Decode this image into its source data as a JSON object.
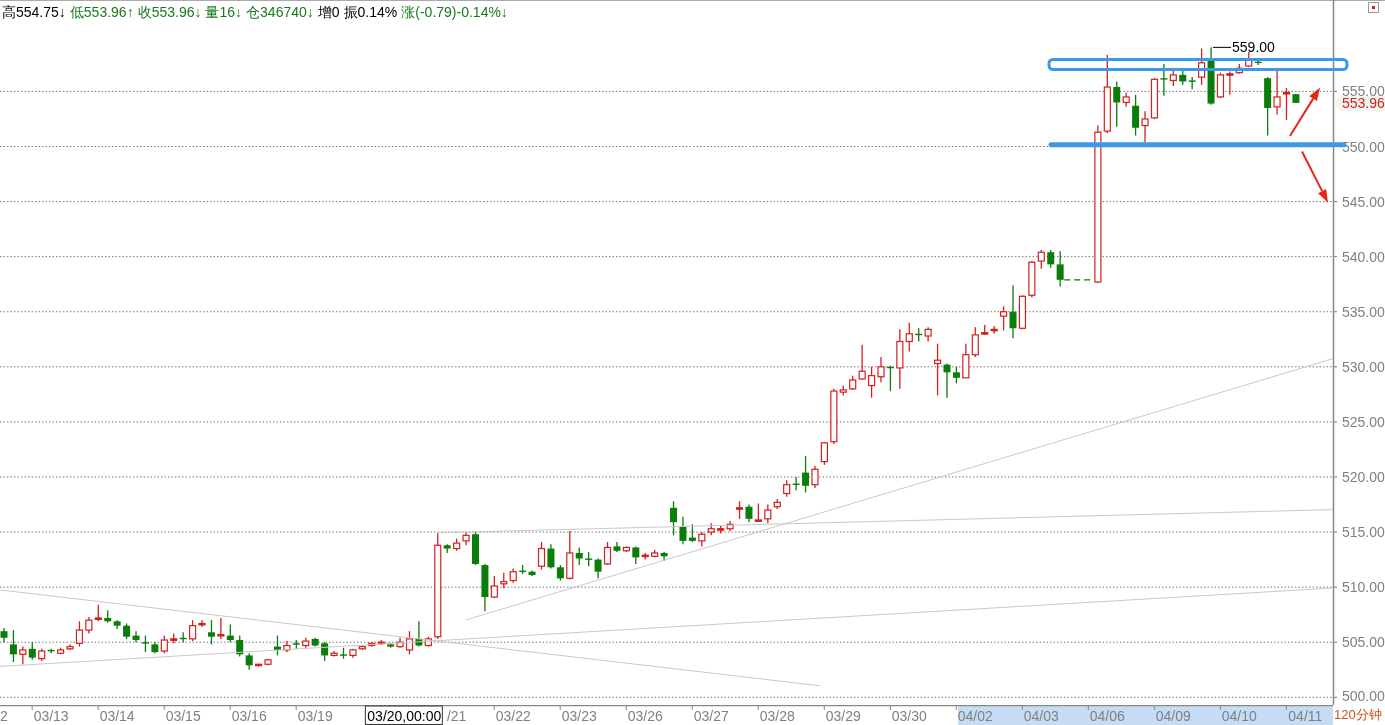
{
  "quote_bar": [
    {
      "text": "高554.75↓",
      "color": "#000000"
    },
    {
      "text": "低553.96↑",
      "color": "#1a7a1a"
    },
    {
      "text": "收553.96↓",
      "color": "#1a7a1a"
    },
    {
      "text": "量16↓",
      "color": "#1a7a1a"
    },
    {
      "text": "仓346740↓",
      "color": "#1a7a1a"
    },
    {
      "text": "增0",
      "color": "#000000"
    },
    {
      "text": "振0.14%",
      "color": "#000000"
    },
    {
      "text": "涨(-0.79)-0.14%↓",
      "color": "#1a7a1a"
    }
  ],
  "chart": {
    "period_label": "120分钟",
    "cursor_label": "03/20,00:00",
    "chart_data": {
      "type": "candlestick",
      "grid": true,
      "ylim": [
        499.3,
        563.3
      ],
      "yticks": [
        {
          "value": 500,
          "label": "500.00"
        },
        {
          "value": 505,
          "label": "505.00"
        },
        {
          "value": 510,
          "label": "510.00"
        },
        {
          "value": 515,
          "label": "515.00"
        },
        {
          "value": 520,
          "label": "520.00"
        },
        {
          "value": 525,
          "label": "525.00"
        },
        {
          "value": 530,
          "label": "530.00"
        },
        {
          "value": 535,
          "label": "535.00"
        },
        {
          "value": 540,
          "label": "540.00"
        },
        {
          "value": 545,
          "label": "545.00"
        },
        {
          "value": 550,
          "label": "550.00"
        },
        {
          "value": 555,
          "label": "555.00"
        }
      ],
      "categories": [
        "2",
        null,
        null,
        null,
        null,
        "03/13",
        null,
        null,
        null,
        null,
        null,
        null,
        "03/14",
        null,
        null,
        null,
        null,
        null,
        null,
        "03/15",
        null,
        null,
        null,
        null,
        null,
        null,
        "03/16",
        null,
        null,
        null,
        null,
        null,
        null,
        "03/19",
        null,
        null,
        null,
        null,
        null,
        null,
        null,
        null,
        null,
        null,
        null,
        null,
        null,
        null,
        "/21",
        null,
        null,
        null,
        null,
        null,
        "03/22",
        null,
        null,
        null,
        null,
        null,
        null,
        "03/23",
        null,
        null,
        null,
        null,
        null,
        null,
        "03/26",
        null,
        null,
        null,
        null,
        null,
        null,
        "03/27",
        null,
        null,
        null,
        null,
        null,
        null,
        "03/28",
        null,
        null,
        null,
        null,
        null,
        null,
        "03/29",
        null,
        null,
        null,
        null,
        null,
        null,
        "03/30",
        null,
        null,
        null,
        null,
        null,
        null,
        "04/02",
        null,
        null,
        null,
        null,
        null,
        null,
        "04/03",
        null,
        null,
        null,
        null,
        null,
        null,
        "04/06",
        null,
        null,
        null,
        null,
        null,
        null,
        "04/09",
        null,
        null,
        null,
        null,
        null,
        null,
        "04/10",
        null,
        null,
        null,
        null,
        null,
        null,
        "04/11"
      ],
      "ohlc": [
        [
          506.0,
          506.3,
          505.0,
          505.4
        ],
        [
          504.8,
          506.1,
          503.2,
          503.9
        ],
        [
          503.9,
          504.6,
          503.0,
          504.3
        ],
        [
          504.4,
          505.0,
          503.4,
          503.6
        ],
        [
          503.5,
          504.4,
          503.3,
          504.2
        ],
        [
          504.3,
          504.4,
          504.0,
          504.2
        ],
        [
          504.0,
          504.5,
          503.9,
          504.3
        ],
        [
          504.4,
          504.8,
          504.3,
          504.6
        ],
        [
          504.9,
          506.9,
          504.6,
          506.1
        ],
        [
          506.1,
          507.3,
          505.8,
          507.0
        ],
        [
          507.1,
          508.4,
          506.9,
          507.2
        ],
        [
          507.2,
          507.9,
          506.8,
          506.9
        ],
        [
          506.9,
          507.0,
          506.2,
          506.5
        ],
        [
          506.5,
          506.7,
          505.3,
          505.5
        ],
        [
          505.6,
          506.0,
          505.0,
          505.2
        ],
        [
          505.0,
          505.6,
          504.1,
          504.9
        ],
        [
          504.8,
          505.0,
          504.0,
          504.1
        ],
        [
          504.2,
          505.6,
          504.0,
          505.2
        ],
        [
          505.2,
          505.8,
          504.9,
          505.3
        ],
        [
          505.4,
          505.9,
          505.0,
          505.3
        ],
        [
          505.3,
          507.0,
          505.1,
          506.5
        ],
        [
          506.6,
          507.0,
          506.4,
          506.7
        ],
        [
          505.9,
          507.0,
          504.8,
          505.5
        ],
        [
          505.6,
          507.2,
          505.3,
          505.7
        ],
        [
          505.6,
          506.6,
          505.0,
          505.2
        ],
        [
          505.2,
          505.6,
          503.7,
          503.9
        ],
        [
          503.8,
          504.0,
          502.5,
          502.9
        ],
        [
          502.9,
          503.0,
          502.8,
          503.0
        ],
        [
          503.0,
          503.5,
          502.9,
          503.4
        ],
        [
          504.6,
          505.6,
          503.8,
          504.3
        ],
        [
          504.3,
          505.1,
          504.1,
          504.7
        ],
        [
          504.9,
          505.2,
          504.4,
          504.8
        ],
        [
          504.7,
          505.4,
          504.5,
          505.1
        ],
        [
          505.3,
          505.4,
          504.6,
          504.7
        ],
        [
          504.9,
          505.0,
          503.3,
          503.8
        ],
        [
          503.8,
          504.2,
          503.7,
          504.0
        ],
        [
          503.9,
          504.5,
          503.5,
          503.8
        ],
        [
          503.8,
          504.4,
          503.6,
          504.3
        ],
        [
          504.4,
          504.7,
          504.3,
          504.6
        ],
        [
          504.7,
          505.0,
          504.6,
          504.9
        ],
        [
          504.9,
          505.2,
          504.8,
          505.0
        ],
        [
          504.8,
          504.9,
          504.5,
          504.6
        ],
        [
          504.6,
          505.4,
          504.5,
          505.0
        ],
        [
          504.3,
          506.0,
          503.9,
          505.3
        ],
        [
          505.3,
          506.9,
          504.6,
          504.7
        ],
        [
          504.7,
          505.5,
          504.6,
          505.3
        ],
        [
          505.5,
          514.9,
          505.3,
          513.8
        ],
        [
          513.8,
          513.9,
          513.1,
          513.5
        ],
        [
          513.5,
          514.4,
          513.3,
          514.0
        ],
        [
          514.2,
          515.0,
          513.8,
          514.7
        ],
        [
          514.8,
          515.0,
          512.0,
          512.1
        ],
        [
          512.0,
          512.1,
          507.8,
          509.1
        ],
        [
          509.1,
          511.0,
          509.0,
          510.1
        ],
        [
          510.3,
          511.3,
          509.9,
          510.5
        ],
        [
          510.6,
          511.7,
          510.4,
          511.4
        ],
        [
          511.5,
          512.0,
          511.2,
          511.4
        ],
        [
          511.4,
          511.5,
          511.0,
          511.1
        ],
        [
          511.9,
          514.1,
          511.6,
          513.5
        ],
        [
          513.5,
          513.9,
          511.7,
          511.8
        ],
        [
          511.8,
          512.0,
          510.6,
          510.8
        ],
        [
          510.8,
          515.1,
          510.7,
          513.1
        ],
        [
          513.1,
          513.6,
          512.0,
          512.6
        ],
        [
          512.6,
          513.2,
          511.9,
          512.5
        ],
        [
          512.5,
          512.6,
          510.8,
          511.4
        ],
        [
          512.1,
          514.1,
          512.0,
          513.6
        ],
        [
          513.7,
          514.1,
          513.2,
          513.3
        ],
        [
          513.3,
          513.7,
          513.2,
          513.6
        ],
        [
          513.6,
          513.7,
          512.1,
          512.7
        ],
        [
          512.8,
          513.1,
          512.5,
          512.9
        ],
        [
          512.8,
          513.4,
          512.7,
          513.1
        ],
        [
          513.1,
          513.2,
          512.4,
          512.8
        ],
        [
          517.2,
          517.8,
          514.7,
          515.9
        ],
        [
          515.5,
          516.4,
          513.9,
          514.2
        ],
        [
          514.5,
          515.7,
          514.1,
          514.2
        ],
        [
          514.2,
          515.0,
          513.7,
          514.8
        ],
        [
          515.0,
          515.8,
          514.7,
          515.3
        ],
        [
          515.2,
          515.6,
          514.9,
          515.3
        ],
        [
          515.3,
          516.0,
          515.1,
          515.7
        ],
        [
          517.1,
          517.8,
          516.2,
          517.2
        ],
        [
          517.3,
          517.5,
          515.9,
          516.2
        ],
        [
          516.0,
          517.6,
          516.0,
          516.1
        ],
        [
          516.2,
          517.5,
          515.8,
          517.0
        ],
        [
          517.3,
          518.0,
          517.1,
          517.7
        ],
        [
          518.5,
          519.7,
          518.2,
          519.3
        ],
        [
          519.4,
          520.0,
          518.8,
          519.3
        ],
        [
          520.4,
          521.9,
          518.6,
          519.2
        ],
        [
          519.3,
          521.0,
          519.0,
          520.7
        ],
        [
          521.4,
          523.2,
          521.1,
          523.1
        ],
        [
          523.2,
          528.0,
          523.0,
          527.8
        ],
        [
          527.7,
          528.3,
          527.4,
          527.9
        ],
        [
          528.0,
          529.2,
          527.9,
          528.8
        ],
        [
          528.9,
          532.0,
          528.8,
          529.6
        ],
        [
          528.3,
          530.0,
          527.2,
          529.2
        ],
        [
          529.1,
          530.9,
          528.6,
          530.0
        ],
        [
          530.0,
          530.1,
          527.8,
          529.9
        ],
        [
          529.9,
          533.4,
          528.0,
          532.3
        ],
        [
          532.3,
          534.0,
          531.4,
          533.0
        ],
        [
          533.0,
          533.5,
          532.3,
          532.9
        ],
        [
          532.8,
          533.6,
          532.3,
          533.4
        ],
        [
          530.3,
          532.1,
          527.4,
          530.6
        ],
        [
          530.2,
          530.3,
          527.2,
          529.5
        ],
        [
          529.5,
          530.0,
          528.5,
          529.0
        ],
        [
          529.0,
          532.1,
          529.0,
          531.1
        ],
        [
          531.1,
          533.6,
          530.9,
          532.9
        ],
        [
          533.0,
          533.8,
          532.9,
          533.1
        ],
        [
          533.3,
          533.7,
          533.0,
          533.4
        ],
        [
          534.6,
          535.5,
          533.3,
          535.0
        ],
        [
          535.0,
          537.4,
          532.6,
          533.5
        ],
        [
          533.5,
          536.5,
          533.4,
          536.4
        ],
        [
          536.5,
          539.6,
          536.3,
          539.5
        ],
        [
          539.6,
          540.6,
          538.9,
          540.4
        ],
        [
          540.4,
          540.6,
          539.0,
          539.3
        ],
        [
          539.3,
          540.5,
          537.3,
          537.9
        ],
        null,
        null,
        null,
        [
          537.7,
          551.9,
          537.6,
          551.3
        ],
        [
          551.4,
          558.3,
          551.2,
          555.4
        ],
        [
          555.4,
          555.9,
          551.8,
          554.0
        ],
        [
          554.0,
          554.9,
          553.6,
          554.5
        ],
        [
          553.7,
          554.7,
          551.0,
          551.7
        ],
        [
          551.9,
          553.2,
          550.4,
          552.5
        ],
        [
          552.6,
          556.2,
          552.5,
          556.1
        ],
        [
          556.2,
          557.5,
          554.6,
          556.1
        ],
        [
          556.0,
          557.0,
          555.5,
          556.5
        ],
        [
          556.5,
          557.0,
          555.6,
          555.9
        ],
        [
          556.0,
          556.3,
          555.2,
          555.9
        ],
        [
          556.3,
          558.9,
          555.6,
          557.6
        ],
        [
          557.8,
          559.0,
          553.8,
          553.9
        ],
        [
          554.5,
          556.7,
          554.4,
          556.5
        ],
        [
          556.5,
          556.8,
          554.7,
          556.6
        ],
        [
          556.7,
          557.5,
          556.6,
          557.1
        ],
        [
          557.3,
          558.6,
          557.2,
          557.9
        ],
        [
          557.7,
          557.8,
          557.4,
          557.6
        ],
        [
          556.2,
          556.3,
          551.0,
          553.5
        ],
        [
          553.6,
          557.0,
          552.9,
          554.5
        ],
        [
          554.8,
          555.3,
          552.4,
          554.9
        ],
        [
          554.75,
          554.75,
          553.96,
          553.96
        ],
        null
      ],
      "annotations": [
        {
          "text": "559.00"
        },
        {
          "text": "553.96"
        }
      ]
    }
  }
}
